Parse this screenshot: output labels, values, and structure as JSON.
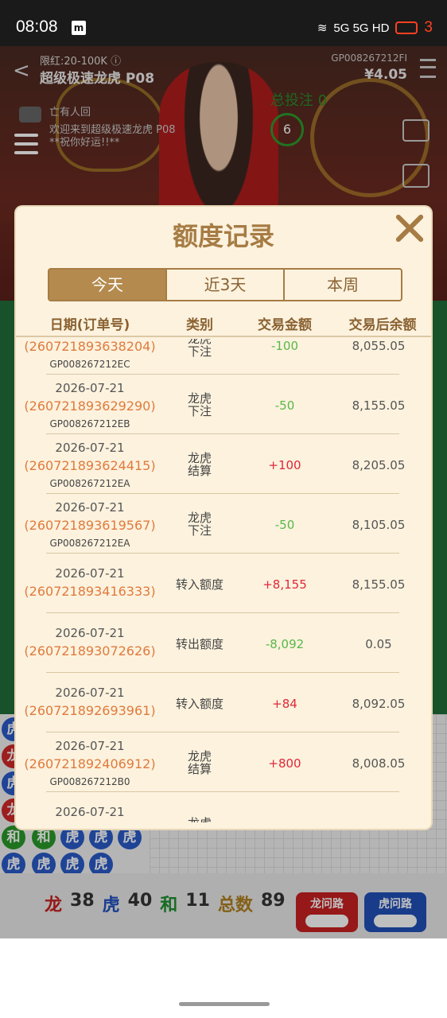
{
  "status_bar": {
    "time": "08:08",
    "notif_icon": "media-icon",
    "network": "5G 5G HD",
    "battery": "3"
  },
  "game": {
    "limit": "限红:20-100K ⓘ",
    "name": "超级极速龙虎 P08",
    "game_id": "GP008267212FI",
    "balance": "¥4.05",
    "total_bet": "总投注 0",
    "countdown": "6",
    "chat_lines": [
      "亡有人回",
      "欢迎来到超级极速龙虎 P08",
      "**祝你好运!!**"
    ],
    "road_counts": {
      "dragon_label": "龙",
      "dragon": "38",
      "tiger_label": "虎",
      "tiger": "40",
      "tie_label": "和",
      "tie": "11",
      "total_label": "总数",
      "total": "89"
    },
    "dragon_road_btn": "龙问路",
    "tiger_road_btn": "虎问路"
  },
  "modal": {
    "title": "额度记录",
    "tabs": [
      "今天",
      "近3天",
      "本周"
    ],
    "active_tab": 0,
    "headers": {
      "date": "日期(订单号)",
      "category": "类别",
      "amount": "交易金额",
      "balance_after": "交易后余额"
    },
    "rows": [
      {
        "date": "",
        "order": "(260721893638204)",
        "gp": "GP008267212EC",
        "category": [
          "龙虎",
          "下注"
        ],
        "amount": "-100",
        "sign": "neg",
        "balance": "8,055.05"
      },
      {
        "date": "2026-07-21",
        "order": "(260721893629290)",
        "gp": "GP008267212EB",
        "category": [
          "龙虎",
          "下注"
        ],
        "amount": "-50",
        "sign": "neg",
        "balance": "8,155.05"
      },
      {
        "date": "2026-07-21",
        "order": "(260721893624415)",
        "gp": "GP008267212EA",
        "category": [
          "龙虎",
          "结算"
        ],
        "amount": "+100",
        "sign": "pos",
        "balance": "8,205.05"
      },
      {
        "date": "2026-07-21",
        "order": "(260721893619567)",
        "gp": "GP008267212EA",
        "category": [
          "龙虎",
          "下注"
        ],
        "amount": "-50",
        "sign": "neg",
        "balance": "8,105.05"
      },
      {
        "date": "2026-07-21",
        "order": "(260721893416333)",
        "gp": "",
        "category": [
          "转入额度"
        ],
        "amount": "+8,155",
        "sign": "pos",
        "balance": "8,155.05"
      },
      {
        "date": "2026-07-21",
        "order": "(260721893072626)",
        "gp": "",
        "category": [
          "转出额度"
        ],
        "amount": "-8,092",
        "sign": "neg",
        "balance": "0.05"
      },
      {
        "date": "2026-07-21",
        "order": "(260721892693961)",
        "gp": "",
        "category": [
          "转入额度"
        ],
        "amount": "+84",
        "sign": "pos",
        "balance": "8,092.05"
      },
      {
        "date": "2026-07-21",
        "order": "(260721892406912)",
        "gp": "GP008267212B0",
        "category": [
          "龙虎",
          "结算"
        ],
        "amount": "+800",
        "sign": "pos",
        "balance": "8,008.05"
      },
      {
        "date": "2026-07-21",
        "order": "",
        "gp": "",
        "category": [
          "龙虎"
        ],
        "amount": "",
        "sign": "neg",
        "balance": ""
      }
    ]
  }
}
